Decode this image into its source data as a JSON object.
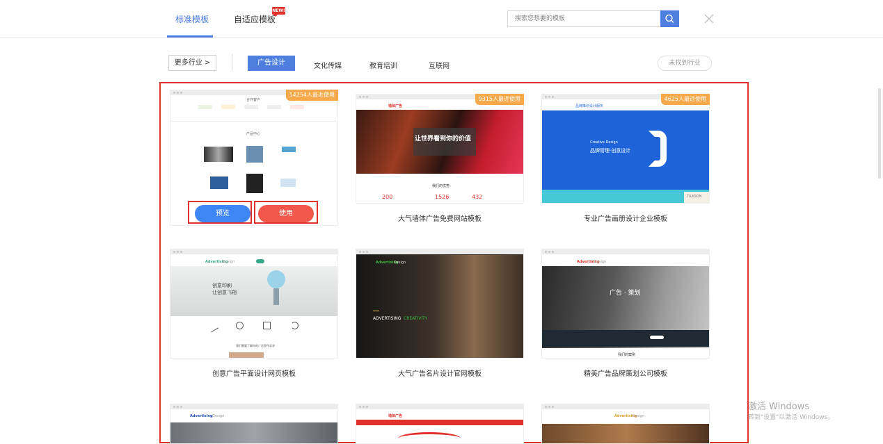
{
  "tabs": [
    {
      "label": "标准模板",
      "active": true
    },
    {
      "label": "自适应模板",
      "badge": "NEW!"
    }
  ],
  "search": {
    "placeholder": "搜索您想要的模板"
  },
  "filters": {
    "more": "更多行业 >",
    "active": "广告设计",
    "items": [
      "文化传媒",
      "教育培训",
      "互联网"
    ],
    "not_found": "未找到行业"
  },
  "cards": [
    {
      "title": "",
      "usage": "14254人最近使用",
      "preview": "预览",
      "use": "使用",
      "thumb": {
        "header": "合作客户",
        "section": "产品中心"
      }
    },
    {
      "title": "大气墙体广告免费网站模板",
      "usage": "9315人最近使用",
      "thumb": {
        "logo": "墙体广告",
        "hero": "让世界看到你的价值",
        "section": "我们的优势",
        "stats": [
          "200",
          "1526",
          "432"
        ]
      }
    },
    {
      "title": "专业广告画册设计企业模板",
      "usage": "4625人最近使用",
      "thumb": {
        "logo": "品牌策划设计服务",
        "line1": "Creative Design",
        "line2": "品牌管理·创意设计",
        "tag": "TILKSON"
      }
    },
    {
      "title": "创意广告平面设计网页模板",
      "thumb": {
        "logo1": "Advertising",
        "logo2": "Design",
        "big1": "创意印刷",
        "big2": "让创意飞翔",
        "bottom": "我们需要了解你的广告宣传诉求"
      }
    },
    {
      "title": "大气广告名片设计官网模板",
      "thumb": {
        "logo1": "Advertising",
        "logo2": "Design",
        "line1": "ADVERTISING",
        "line2": "CREATIVITY"
      }
    },
    {
      "title": "精美广告品牌策划公司模板",
      "thumb": {
        "logo1": "Advertising",
        "logo2": "Design",
        "hero": "广告 · 策划",
        "section": "我们的案例"
      }
    },
    {
      "title": "",
      "thumb": {
        "logo1": "Advertising",
        "logo2": "Design"
      }
    },
    {
      "title": "",
      "thumb": {
        "logo": "墙体广告"
      }
    },
    {
      "title": "",
      "thumb": {
        "logo1": "Advertising",
        "logo2": "Design"
      }
    }
  ],
  "watermark": {
    "line1": "激活 Windows",
    "line2": "转到\"设置\"以激活 Windows。"
  },
  "colors": {
    "accent": "#4f7ee1",
    "badge": "#f6a94a",
    "frame": "#e0322b",
    "use": "#f2574a",
    "preview": "#3e86f5"
  }
}
